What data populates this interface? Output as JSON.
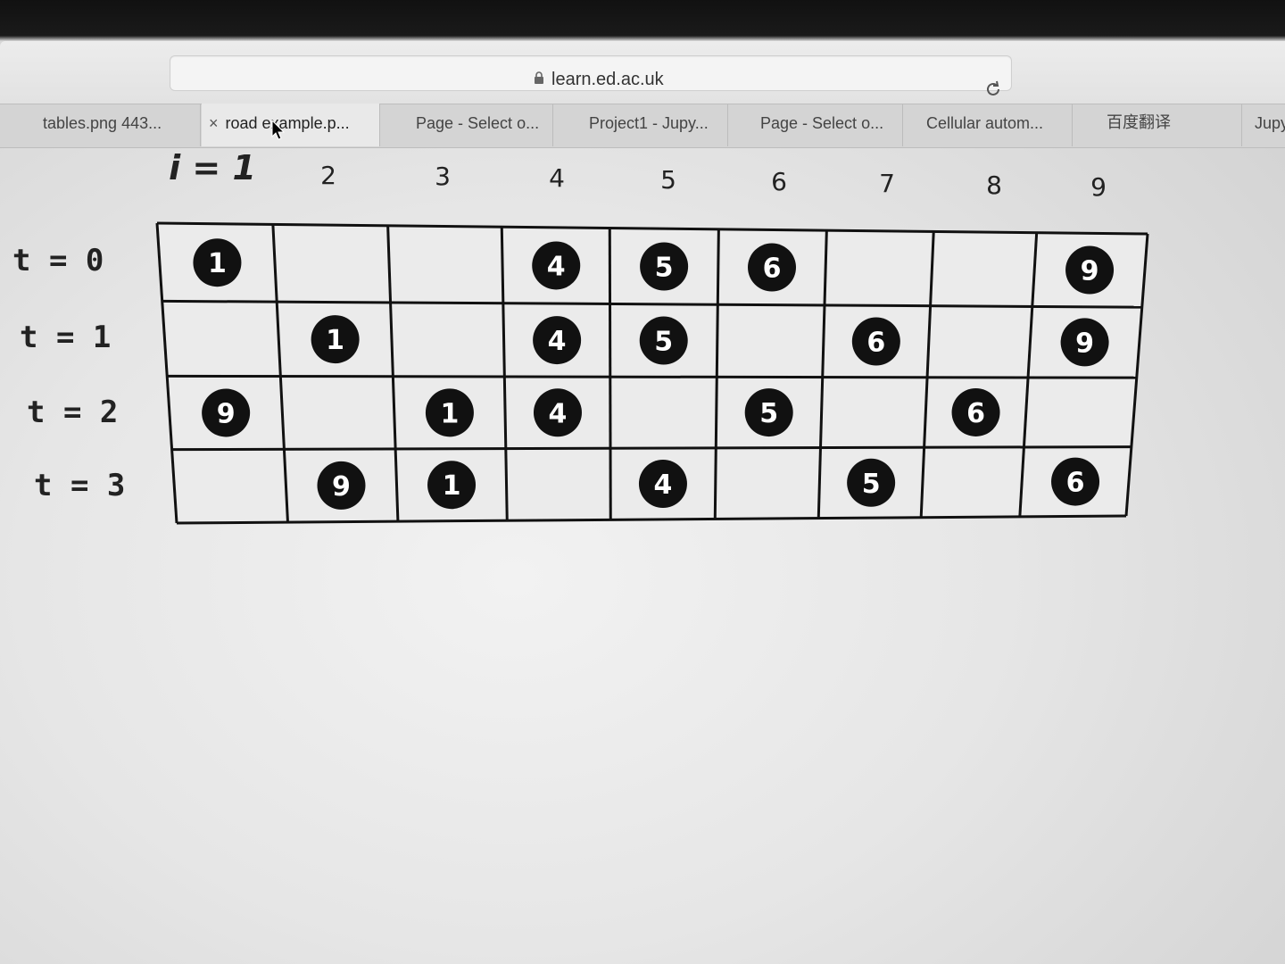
{
  "browser": {
    "url": "learn.ed.ac.uk",
    "tabs": [
      {
        "label": "tables.png 443...",
        "active": false
      },
      {
        "label": "road example.p...",
        "active": true,
        "close_glyph": "×"
      },
      {
        "label": "Page - Select o...",
        "active": false
      },
      {
        "label": "Project1 - Jupy...",
        "active": false
      },
      {
        "label": "Page - Select o...",
        "active": false
      },
      {
        "label": "Cellular autom...",
        "active": false
      },
      {
        "label": "百度翻译",
        "active": false
      },
      {
        "label": "Jupy",
        "active": false
      }
    ]
  },
  "table": {
    "column_label": "i = 1",
    "column_numbers": [
      "2",
      "3",
      "4",
      "5",
      "6",
      "7",
      "8",
      "9"
    ],
    "row_labels": [
      "t = 0",
      "t = 1",
      "t = 2",
      "t = 3"
    ],
    "rows": [
      [
        "1",
        "",
        "",
        "4",
        "5",
        "6",
        "",
        "",
        "9"
      ],
      [
        "",
        "1",
        "",
        "4",
        "5",
        "",
        "6",
        "",
        "9"
      ],
      [
        "9",
        "",
        "1",
        "4",
        "",
        "5",
        "",
        "6",
        ""
      ],
      [
        "",
        "9",
        "1",
        "",
        "4",
        "",
        "5",
        "",
        "6"
      ]
    ]
  },
  "colors": {
    "dot_fill": "#111111",
    "dot_text": "#ffffff",
    "grid_line": "#111111",
    "cell_bg": "#ebebeb"
  }
}
